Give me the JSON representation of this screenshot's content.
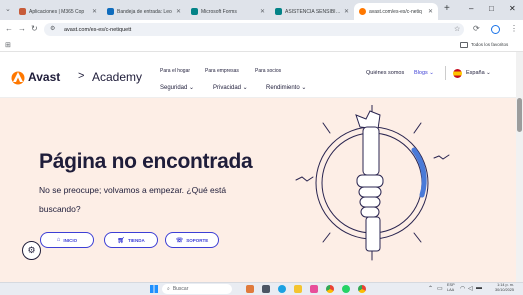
{
  "browser": {
    "tabs": [
      {
        "title": "Aplicaciones | M365 Cop",
        "color": "#c75b39"
      },
      {
        "title": "Bandeja de entrada: Leo",
        "color": "#0f6cbd"
      },
      {
        "title": "Microsoft Forms",
        "color": "#038387"
      },
      {
        "title": "ASISTENCIA SENSIBILIZ",
        "color": "#038387"
      },
      {
        "title": "avast.com/es-es/c-netiq",
        "color": "#ff7800"
      }
    ],
    "new_tab": "+",
    "window_controls": {
      "minimize": "–",
      "maximize": "□",
      "close": "✕"
    },
    "url": "avast.com/es-es/c-netiquett",
    "bookmarks_all_label": "Todos los favoritos"
  },
  "site": {
    "logo_text": "Avast",
    "logo_arrow": ">",
    "academy_label": "Academy",
    "nav_top": [
      "Para el hogar",
      "Para empresas",
      "Para socios"
    ],
    "nav_bottom": [
      "Seguridad",
      "Privacidad",
      "Rendimiento"
    ],
    "about_label": "Quiénes somos",
    "blogs_label": "Blogs",
    "country_label": "España",
    "accent_color": "#ff7800",
    "link_color": "#3d3fd5"
  },
  "hero": {
    "title": "Página no encontrada",
    "subtitle_line1": "No se preocupe; volvamos a empezar. ¿Qué está",
    "subtitle_line2": "buscando?",
    "buttons": [
      {
        "label": "INICIO",
        "icon": "home-icon"
      },
      {
        "label": "TIENDA",
        "icon": "cart-icon"
      },
      {
        "label": "SOPORTE",
        "icon": "support-icon"
      }
    ]
  },
  "taskbar": {
    "search_label": "Buscar",
    "lang_line1": "ESP",
    "lang_line2": "LAA",
    "time": "1:14 p. m.",
    "date": "30/10/2025"
  }
}
